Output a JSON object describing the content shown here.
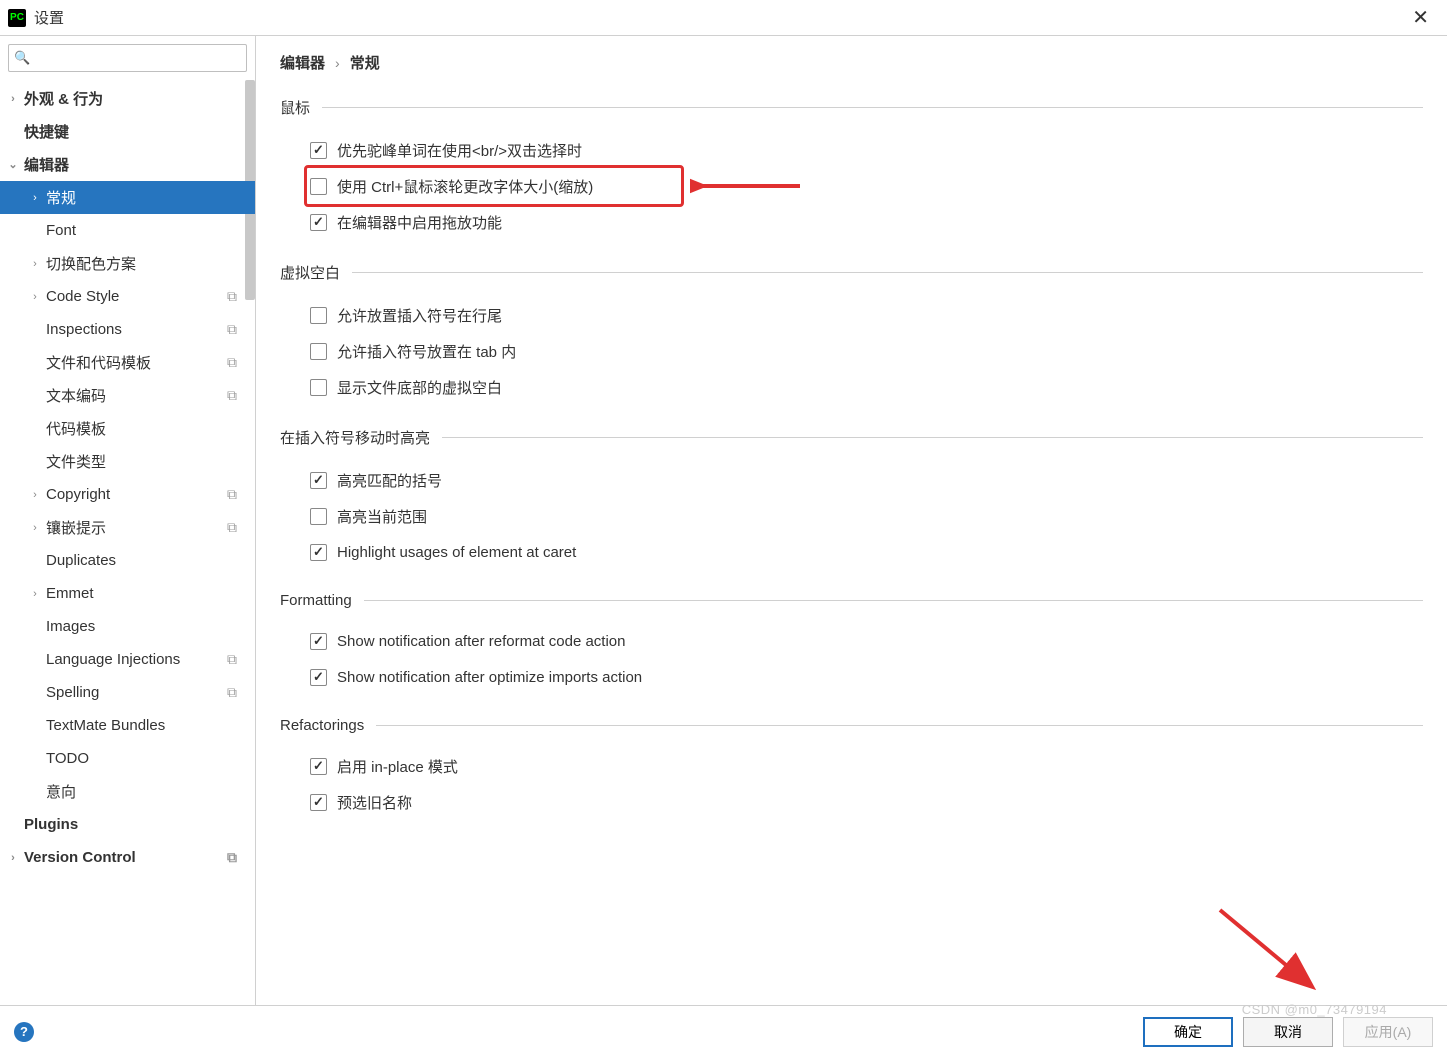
{
  "window": {
    "title": "设置"
  },
  "sidebar": {
    "search_placeholder": "",
    "items": [
      {
        "label": "外观 & 行为",
        "level": 0,
        "chev": "›",
        "bold": true
      },
      {
        "label": "快捷键",
        "level": 0,
        "chev": "",
        "bold": true
      },
      {
        "label": "编辑器",
        "level": 0,
        "chev": "⌄",
        "bold": true
      },
      {
        "label": "常规",
        "level": 1,
        "chev": "›",
        "selected": true
      },
      {
        "label": "Font",
        "level": 1,
        "chev": ""
      },
      {
        "label": "切换配色方案",
        "level": 1,
        "chev": "›"
      },
      {
        "label": "Code Style",
        "level": 1,
        "chev": "›",
        "scope": true
      },
      {
        "label": "Inspections",
        "level": 1,
        "chev": "",
        "scope": true
      },
      {
        "label": "文件和代码模板",
        "level": 1,
        "chev": "",
        "scope": true
      },
      {
        "label": "文本编码",
        "level": 1,
        "chev": "",
        "scope": true
      },
      {
        "label": "代码模板",
        "level": 1,
        "chev": ""
      },
      {
        "label": "文件类型",
        "level": 1,
        "chev": ""
      },
      {
        "label": "Copyright",
        "level": 1,
        "chev": "›",
        "scope": true
      },
      {
        "label": "镶嵌提示",
        "level": 1,
        "chev": "›",
        "scope": true
      },
      {
        "label": "Duplicates",
        "level": 1,
        "chev": ""
      },
      {
        "label": "Emmet",
        "level": 1,
        "chev": "›"
      },
      {
        "label": "Images",
        "level": 1,
        "chev": ""
      },
      {
        "label": "Language Injections",
        "level": 1,
        "chev": "",
        "scope": true
      },
      {
        "label": "Spelling",
        "level": 1,
        "chev": "",
        "scope": true
      },
      {
        "label": "TextMate Bundles",
        "level": 1,
        "chev": ""
      },
      {
        "label": "TODO",
        "level": 1,
        "chev": ""
      },
      {
        "label": "意向",
        "level": 1,
        "chev": ""
      },
      {
        "label": "Plugins",
        "level": 0,
        "chev": "",
        "bold": true
      },
      {
        "label": "Version Control",
        "level": 0,
        "chev": "›",
        "bold": true,
        "scope": true
      }
    ]
  },
  "breadcrumb": {
    "root": "编辑器",
    "leaf": "常规"
  },
  "sections": {
    "mouse": {
      "title": "鼠标",
      "opts": [
        {
          "label": "优先驼峰单词在使用<br/>双击选择时",
          "checked": true
        },
        {
          "label": "使用 Ctrl+鼠标滚轮更改字体大小(缩放)",
          "checked": false,
          "highlight": true
        },
        {
          "label": "在编辑器中启用拖放功能",
          "checked": true
        }
      ]
    },
    "vspace": {
      "title": "虚拟空白",
      "opts": [
        {
          "label": "允许放置插入符号在行尾",
          "checked": false
        },
        {
          "label": "允许插入符号放置在 tab 内",
          "checked": false
        },
        {
          "label": "显示文件底部的虚拟空白",
          "checked": false
        }
      ]
    },
    "caret": {
      "title": "在插入符号移动时高亮",
      "opts": [
        {
          "label": "高亮匹配的括号",
          "checked": true
        },
        {
          "label": "高亮当前范围",
          "checked": false
        },
        {
          "label": "Highlight usages of element at caret",
          "checked": true
        }
      ]
    },
    "formatting": {
      "title": "Formatting",
      "opts": [
        {
          "label": "Show notification after reformat code action",
          "checked": true
        },
        {
          "label": "Show notification after optimize imports action",
          "checked": true
        }
      ]
    },
    "refactorings": {
      "title": "Refactorings",
      "opts": [
        {
          "label": "启用 in-place 模式",
          "checked": true
        },
        {
          "label": "预选旧名称",
          "checked": true
        }
      ]
    }
  },
  "footer": {
    "ok": "确定",
    "cancel": "取消",
    "apply": "应用(A)"
  },
  "watermark": "CSDN @m0_73479194"
}
